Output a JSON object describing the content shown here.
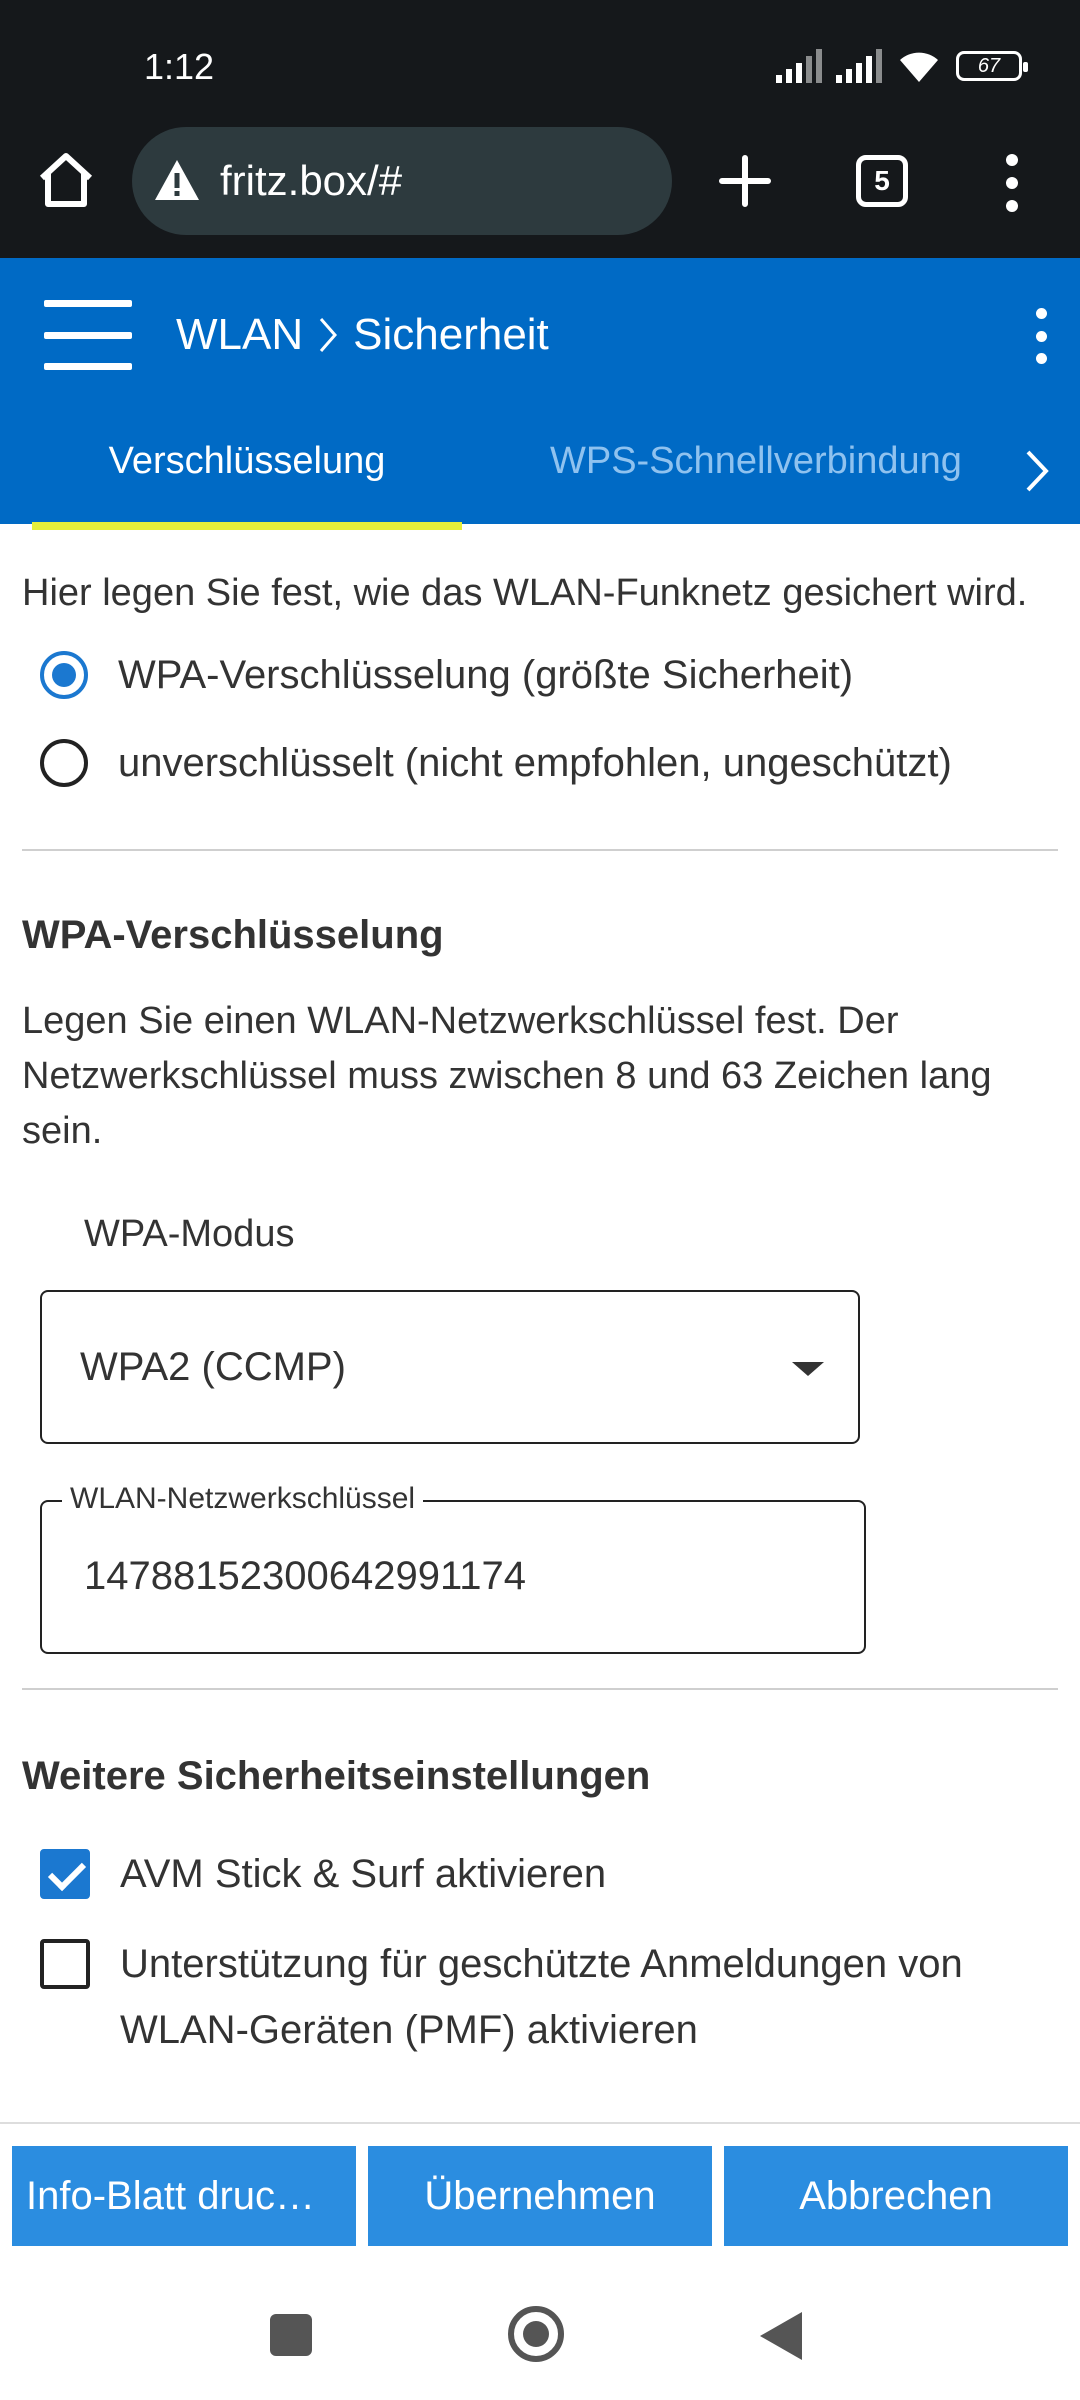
{
  "status_bar": {
    "time": "1:12",
    "battery": "67"
  },
  "browser": {
    "url": "fritz.box/#",
    "tab_count": "5"
  },
  "header": {
    "breadcrumb": [
      "WLAN",
      "Sicherheit"
    ],
    "tabs": [
      {
        "label": "Verschlüsselung",
        "active": true
      },
      {
        "label": "WPS-Schnellverbindung",
        "active": false
      }
    ]
  },
  "intro_text": "Hier legen Sie fest, wie das WLAN-Funknetz gesichert wird.",
  "encryption_options": [
    {
      "label": "WPA-Verschlüsselung (größte Sicherheit)",
      "selected": true
    },
    {
      "label": "unverschlüsselt (nicht empfohlen, ungeschützt)",
      "selected": false
    }
  ],
  "wpa_section": {
    "title": "WPA-Verschlüsselung",
    "description": "Legen Sie einen WLAN-Netzwerkschlüssel fest. Der Netzwerkschlüssel muss zwischen 8 und 63 Zeichen lang sein.",
    "mode_label": "WPA-Modus",
    "mode_value": "WPA2 (CCMP)",
    "key_label": "WLAN-Netzwerkschlüssel",
    "key_value": "14788152300642991174"
  },
  "more_section": {
    "title": "Weitere Sicherheitseinstellungen",
    "options": [
      {
        "label": "AVM Stick & Surf aktivieren",
        "checked": true
      },
      {
        "label": "Unterstützung für geschützte Anmeldungen von WLAN-Geräten (PMF) aktivieren",
        "checked": false
      }
    ]
  },
  "actions": {
    "print_label": "Info-Blatt druc…",
    "apply_label": "Übernehmen",
    "cancel_label": "Abbrechen"
  },
  "colors": {
    "brand": "#006ac5",
    "tab_indicator": "#e6ef3a",
    "button": "#2b8de0",
    "control": "#1b78d0"
  }
}
